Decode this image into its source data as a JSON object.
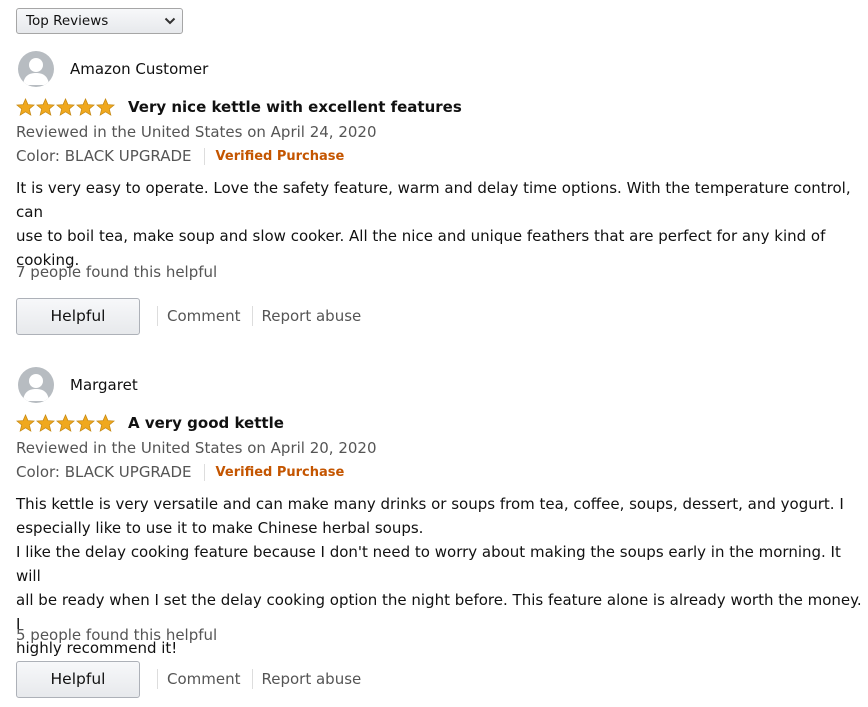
{
  "sort": {
    "selected": "Top Reviews"
  },
  "colors": {
    "star": "#f0a81e",
    "verified": "#c45500",
    "muted": "#555555"
  },
  "reviews": [
    {
      "author": "Amazon Customer",
      "rating": 5,
      "title": "Very nice kettle with excellent features",
      "date": "Reviewed in the United States on April 24, 2020",
      "variant": "Color: BLACK UPGRADE",
      "verified": "Verified Purchase",
      "body_lines": [
        "It is very easy to operate. Love the safety feature, warm and delay time options. With the temperature control, can",
        "use to boil tea, make soup and slow cooker. All the nice and unique feathers that are perfect for any kind of",
        "cooking."
      ],
      "helpful_count": "7 people found this helpful",
      "helpful_label": "Helpful",
      "comment_label": "Comment",
      "report_label": "Report abuse"
    },
    {
      "author": "Margaret",
      "rating": 5,
      "title": "A very good kettle",
      "date": "Reviewed in the United States on April 20, 2020",
      "variant": "Color: BLACK UPGRADE",
      "verified": "Verified Purchase",
      "body_lines": [
        "This kettle is very versatile and can make many drinks or soups from tea, coffee, soups, dessert,  and yogurt.  I",
        "especially like to use it to make Chinese herbal soups.",
        "I like the delay cooking feature because I don't need to worry about making the soups early in the morning.  It will",
        "all be ready when I set the delay cooking option the night before.  This feature alone is already worth the money.  I",
        "highly recommend it!"
      ],
      "helpful_count": "5 people found this helpful",
      "helpful_label": "Helpful",
      "comment_label": "Comment",
      "report_label": "Report abuse"
    }
  ]
}
